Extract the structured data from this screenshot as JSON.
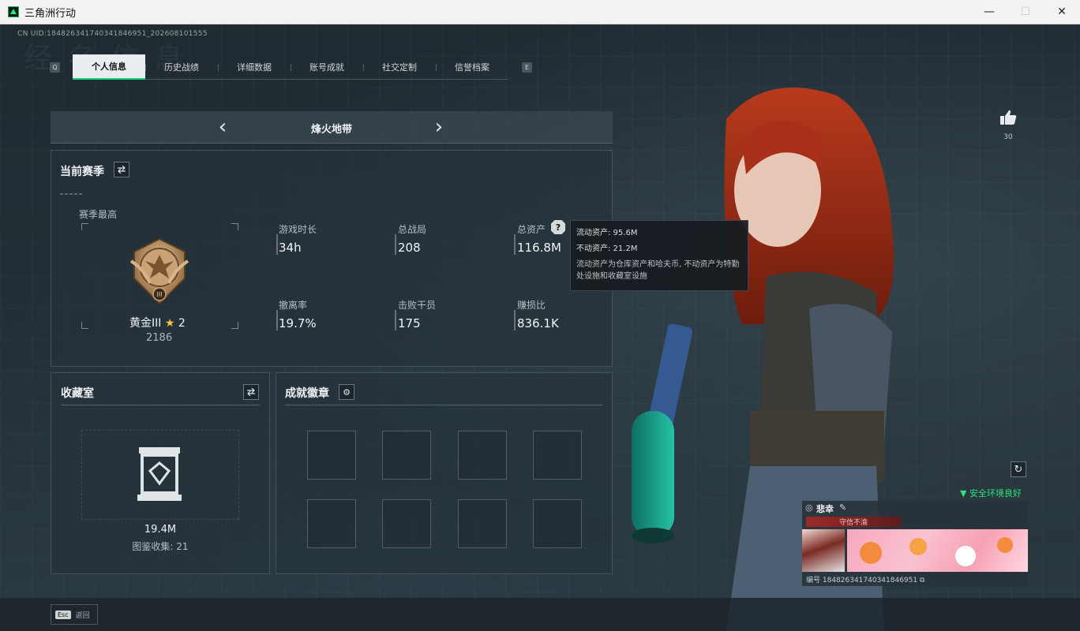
{
  "window": {
    "title": "三角洲行动",
    "buttons": [
      "—",
      "☐",
      "✕"
    ]
  },
  "uid": "CN UID:18482634174034184695​1_202608101555",
  "bg_title": "经 名 信 息",
  "tabs": {
    "left_key": "Q",
    "right_key": "E",
    "items": [
      {
        "label": "个人信息",
        "active": true
      },
      {
        "label": "历史战绩",
        "active": false
      },
      {
        "label": "详细数据",
        "active": false
      },
      {
        "label": "账号成就",
        "active": false
      },
      {
        "label": "社交定制",
        "active": false
      },
      {
        "label": "信誉档案",
        "active": false
      }
    ]
  },
  "mode": {
    "title": "烽火地带",
    "prev": "‹",
    "next": "›"
  },
  "season": {
    "title": "当前赛季",
    "best_label": "赛季最高",
    "rank_name": "黄金III",
    "rank_stars": "2",
    "rank_points": "2186",
    "stats": [
      {
        "label": "游戏时长",
        "value": "34h"
      },
      {
        "label": "总战局",
        "value": "208"
      },
      {
        "label": "总资产",
        "value": "116.8M"
      },
      {
        "label": "撤离率",
        "value": "19.7%"
      },
      {
        "label": "击败干员",
        "value": "175"
      },
      {
        "label": "赚损比",
        "value": "836.1K"
      }
    ]
  },
  "tooltip": {
    "line1": "流动资产: 95.6M",
    "line2": "不动资产: 21.2M",
    "desc": "流动资产为仓库资产和哈夫币, 不动资产为特勤处设施和收藏室设施"
  },
  "collection": {
    "title": "收藏室",
    "value": "19.4M",
    "caption": "图鉴收集: 21"
  },
  "achievements": {
    "title": "成就徽章"
  },
  "like": {
    "count": "30"
  },
  "status": {
    "safe": "安全环境良好"
  },
  "card": {
    "name": "悲幸",
    "badge": "守信不渝",
    "id": "编号 18482634174034184695​1"
  },
  "footer": {
    "esc_key": "Esc",
    "back_label": "返回"
  },
  "colors": {
    "accent": "#1fd07a",
    "safe": "#2ee27e",
    "tooltip_bg": "#161c20"
  }
}
